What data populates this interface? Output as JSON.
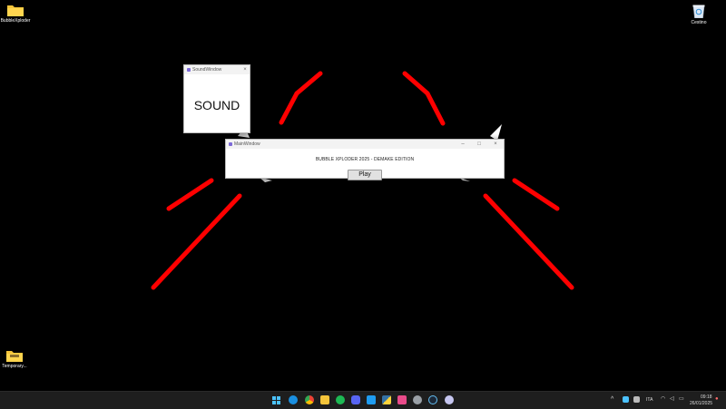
{
  "desktop": {
    "icons": [
      {
        "label": "BubbleXploder"
      },
      {
        "label": "Temporary..."
      },
      {
        "label": "Cestino"
      }
    ]
  },
  "sound_window": {
    "title": "SoundWindow",
    "content": "SOUND"
  },
  "main_window": {
    "title": "MainWindow",
    "heading": "BUBBLE XPLODER 2025 - DEMAKE EDITION",
    "play_label": "Play"
  },
  "taskbar": {
    "apps": [
      "windows-start",
      "edge",
      "chrome",
      "file-explorer",
      "spotify",
      "discord",
      "vscode",
      "python",
      "store",
      "settings",
      "steam",
      "app"
    ],
    "tray": {
      "language": "ITA",
      "time": "09:18",
      "date": "26/01/2025"
    }
  },
  "colors": {
    "desktop_bg": "#000000",
    "burst_lines": "#ff0000",
    "taskbar_bg": "#1e1e1e"
  }
}
